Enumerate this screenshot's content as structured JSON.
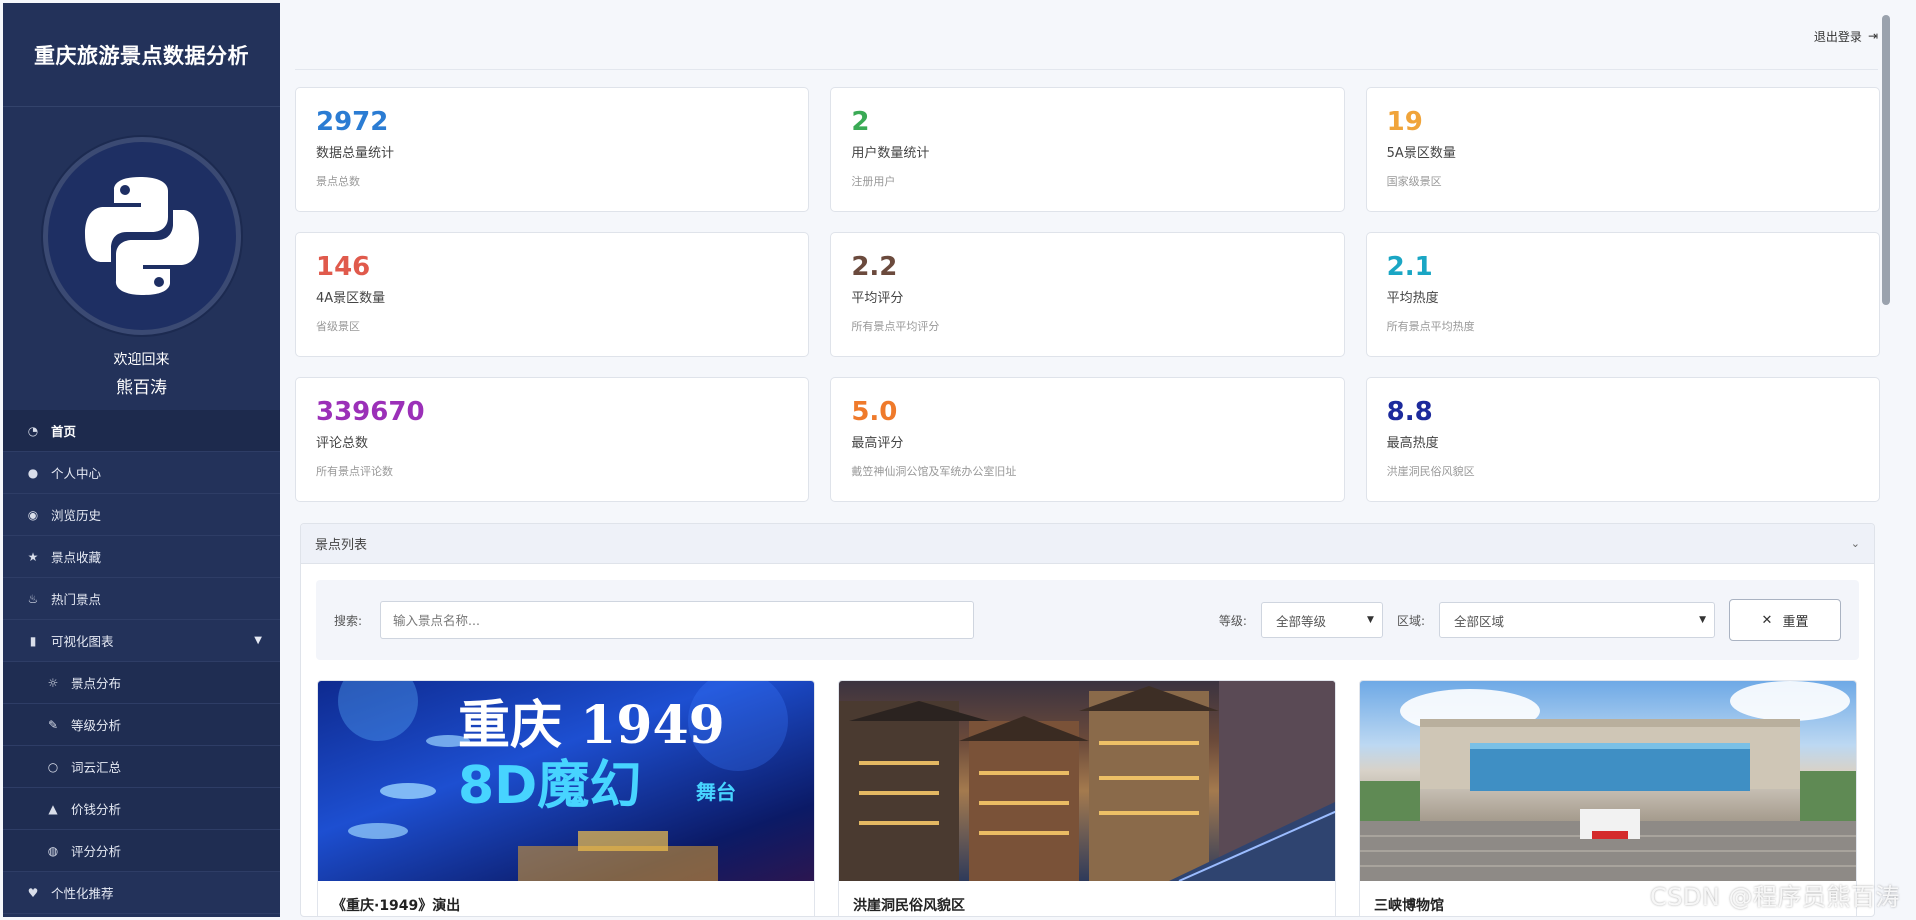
{
  "sidebar": {
    "brand": "重庆旅游景点数据分析",
    "welcome": "欢迎回来",
    "username": "熊百涛",
    "menu": [
      {
        "label": "首页",
        "icon": "dashboard-icon"
      },
      {
        "label": "个人中心",
        "icon": "user-icon"
      },
      {
        "label": "浏览历史",
        "icon": "eye-icon"
      },
      {
        "label": "景点收藏",
        "icon": "star-icon"
      },
      {
        "label": "热门景点",
        "icon": "fire-icon"
      },
      {
        "label": "可视化图表",
        "icon": "bar-chart-icon"
      },
      {
        "label": "景点分布",
        "icon": "sun-icon"
      },
      {
        "label": "等级分析",
        "icon": "feather-icon"
      },
      {
        "label": "词云汇总",
        "icon": "lightbulb-icon"
      },
      {
        "label": "价钱分析",
        "icon": "graduation-cap-icon"
      },
      {
        "label": "评分分析",
        "icon": "globe-icon"
      },
      {
        "label": "个性化推荐",
        "icon": "heart-icon"
      }
    ]
  },
  "topbar": {
    "logout": "退出登录"
  },
  "stats": [
    {
      "value": "2972",
      "label": "数据总量统计",
      "sub": "景点总数",
      "color": "#2b7cd3"
    },
    {
      "value": "2",
      "label": "用户数量统计",
      "sub": "注册用户",
      "color": "#3aaa55"
    },
    {
      "value": "19",
      "label": "5A景区数量",
      "sub": "国家级景区",
      "color": "#f0a43a"
    },
    {
      "value": "146",
      "label": "4A景区数量",
      "sub": "省级景区",
      "color": "#e05a4c"
    },
    {
      "value": "2.2",
      "label": "平均评分",
      "sub": "所有景点平均评分",
      "color": "#6b4a3d"
    },
    {
      "value": "2.1",
      "label": "平均热度",
      "sub": "所有景点平均热度",
      "color": "#1aa6c4"
    },
    {
      "value": "339670",
      "label": "评论总数",
      "sub": "所有景点评论数",
      "color": "#9b30b8"
    },
    {
      "value": "5.0",
      "label": "最高评分",
      "sub": "戴笠神仙洞公馆及军统办公室旧址",
      "color": "#ef7a2b"
    },
    {
      "value": "8.8",
      "label": "最高热度",
      "sub": "洪崖洞民俗风貌区",
      "color": "#1c2a9c"
    }
  ],
  "panel": {
    "title": "景点列表",
    "search_label": "搜索:",
    "search_placeholder": "输入景点名称...",
    "level_label": "等级:",
    "level_value": "全部等级",
    "region_label": "区域:",
    "region_value": "全部区域",
    "reset_label": "重置"
  },
  "spots": [
    {
      "name": "《重庆·1949》演出",
      "img_title": "重庆 1949",
      "img_sub": "8D魔幻",
      "img_sub2": "舞台"
    },
    {
      "name": "洪崖洞民俗风貌区"
    },
    {
      "name": "三峡博物馆"
    }
  ],
  "watermark": "CSDN @程序员熊百涛"
}
